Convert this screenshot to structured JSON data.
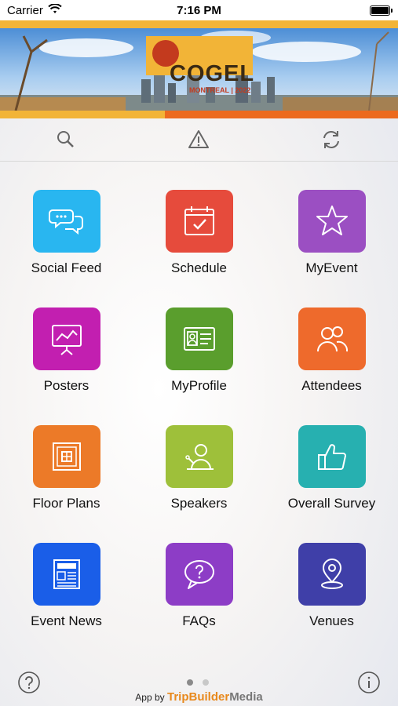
{
  "status_bar": {
    "carrier": "Carrier",
    "time": "7:16 PM"
  },
  "banner": {
    "logo_text": "COGEL",
    "logo_sub": "MONTREAL | 2022"
  },
  "toolbar": {
    "items": [
      "search-icon",
      "alert-icon",
      "refresh-icon"
    ]
  },
  "tiles": [
    {
      "label": "Social Feed",
      "color": "#29b6f0",
      "icon": "chat-bubbles-icon"
    },
    {
      "label": "Schedule",
      "color": "#e64b3c",
      "icon": "calendar-icon"
    },
    {
      "label": "MyEvent",
      "color": "#9b4fc2",
      "icon": "star-icon"
    },
    {
      "label": "Posters",
      "color": "#c21fb0",
      "icon": "presentation-icon"
    },
    {
      "label": "MyProfile",
      "color": "#5a9e2d",
      "icon": "id-card-icon"
    },
    {
      "label": "Attendees",
      "color": "#ee6a2c",
      "icon": "people-icon"
    },
    {
      "label": "Floor Plans",
      "color": "#ec7a28",
      "icon": "floor-plan-icon"
    },
    {
      "label": "Speakers",
      "color": "#9ec03a",
      "icon": "speaker-icon"
    },
    {
      "label": "Overall Survey",
      "color": "#27b0b0",
      "icon": "thumbs-up-icon"
    },
    {
      "label": "Event News",
      "color": "#1a5ee8",
      "icon": "newspaper-icon"
    },
    {
      "label": "FAQs",
      "color": "#8d3dc6",
      "icon": "faq-icon"
    },
    {
      "label": "Venues",
      "color": "#3f3fa8",
      "icon": "location-pin-icon"
    }
  ],
  "pagination": {
    "pages": 2,
    "current": 1
  },
  "footer": {
    "credit_prefix": "App by",
    "brand_a": "TripBuilder",
    "brand_b": "Media"
  }
}
